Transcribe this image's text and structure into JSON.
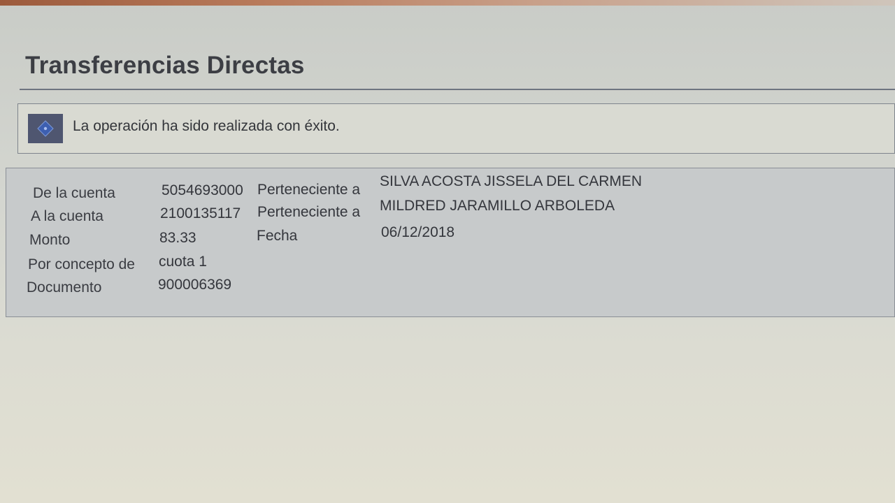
{
  "page": {
    "title": "Transferencias Directas"
  },
  "message": {
    "text": "La operación ha sido realizada con éxito.",
    "icon": "info-icon"
  },
  "details": {
    "from_account": {
      "label": "De la cuenta",
      "number": "5054693000",
      "owner_label": "Perteneciente a",
      "owner": "SILVA ACOSTA JISSELA DEL CARMEN"
    },
    "to_account": {
      "label": "A la cuenta",
      "number": "2100135117",
      "owner_label": "Perteneciente a",
      "owner": "MILDRED JARAMILLO ARBOLEDA"
    },
    "amount": {
      "label": "Monto",
      "value": "83.33",
      "date_label": "Fecha",
      "date": "06/12/2018"
    },
    "concept": {
      "label": "Por concepto de",
      "value": "cuota 1"
    },
    "document": {
      "label": "Documento",
      "value": "900006369"
    }
  },
  "colors": {
    "title_text": "#3c3e44",
    "icon_background": "#4f5670",
    "panel_background": "#c7cacb"
  }
}
